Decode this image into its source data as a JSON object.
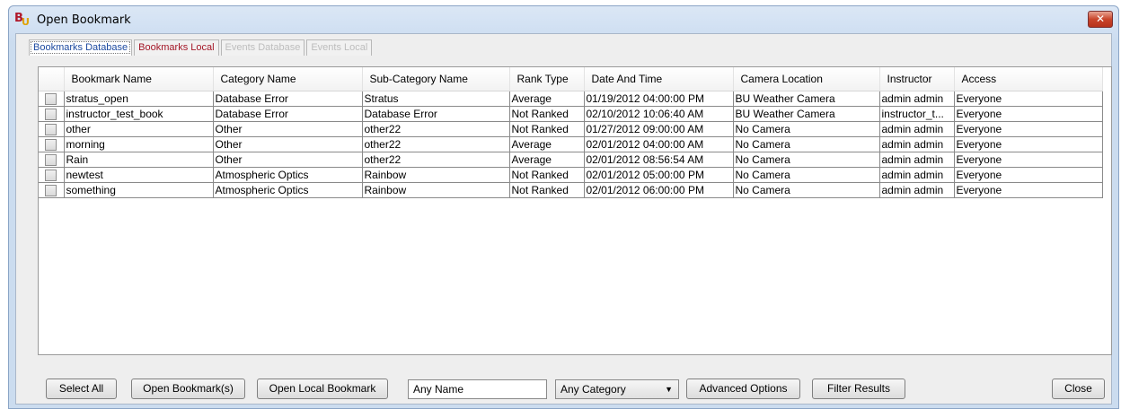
{
  "window": {
    "title": "Open Bookmark",
    "close_glyph": "✕"
  },
  "tabs": [
    {
      "label": "Bookmarks Database",
      "state": "active"
    },
    {
      "label": "Bookmarks Local",
      "state": "normal"
    },
    {
      "label": "Events Database",
      "state": "disabled"
    },
    {
      "label": "Events Local",
      "state": "disabled"
    }
  ],
  "table": {
    "columns": [
      "",
      "Bookmark Name",
      "Category Name",
      "Sub-Category Name",
      "Rank Type",
      "Date And Time",
      "Camera Location",
      "Instructor",
      "Access"
    ],
    "rows": [
      [
        "stratus_open",
        "Database Error",
        "Stratus",
        "Average",
        "01/19/2012 04:00:00 PM",
        "BU Weather Camera",
        "admin admin",
        "Everyone"
      ],
      [
        "instructor_test_book",
        "Database Error",
        "Database Error",
        "Not Ranked",
        "02/10/2012 10:06:40 AM",
        "BU Weather Camera",
        "instructor_t...",
        "Everyone"
      ],
      [
        "other",
        "Other",
        "other22",
        "Not Ranked",
        "01/27/2012 09:00:00 AM",
        "No Camera",
        "admin admin",
        "Everyone"
      ],
      [
        "morning",
        "Other",
        "other22",
        "Average",
        "02/01/2012 04:00:00 AM",
        "No Camera",
        "admin admin",
        "Everyone"
      ],
      [
        "Rain",
        "Other",
        "other22",
        "Average",
        "02/01/2012 08:56:54 AM",
        "No Camera",
        "admin admin",
        "Everyone"
      ],
      [
        "newtest",
        "Atmospheric Optics",
        "Rainbow",
        "Not Ranked",
        "02/01/2012 05:00:00 PM",
        "No Camera",
        "admin admin",
        "Everyone"
      ],
      [
        "something",
        "Atmospheric Optics",
        "Rainbow",
        "Not Ranked",
        "02/01/2012 06:00:00 PM",
        "No Camera",
        "admin admin",
        "Everyone"
      ]
    ]
  },
  "bottom": {
    "select_all": "Select All",
    "open_bookmarks": "Open Bookmark(s)",
    "open_local": "Open Local Bookmark",
    "name_filter_value": "Any Name",
    "category_select_value": "Any Category",
    "advanced": "Advanced Options",
    "filter": "Filter Results",
    "close": "Close"
  },
  "icons": {
    "app": "app-logo-icon",
    "dropdown": "chevron-down-icon"
  }
}
